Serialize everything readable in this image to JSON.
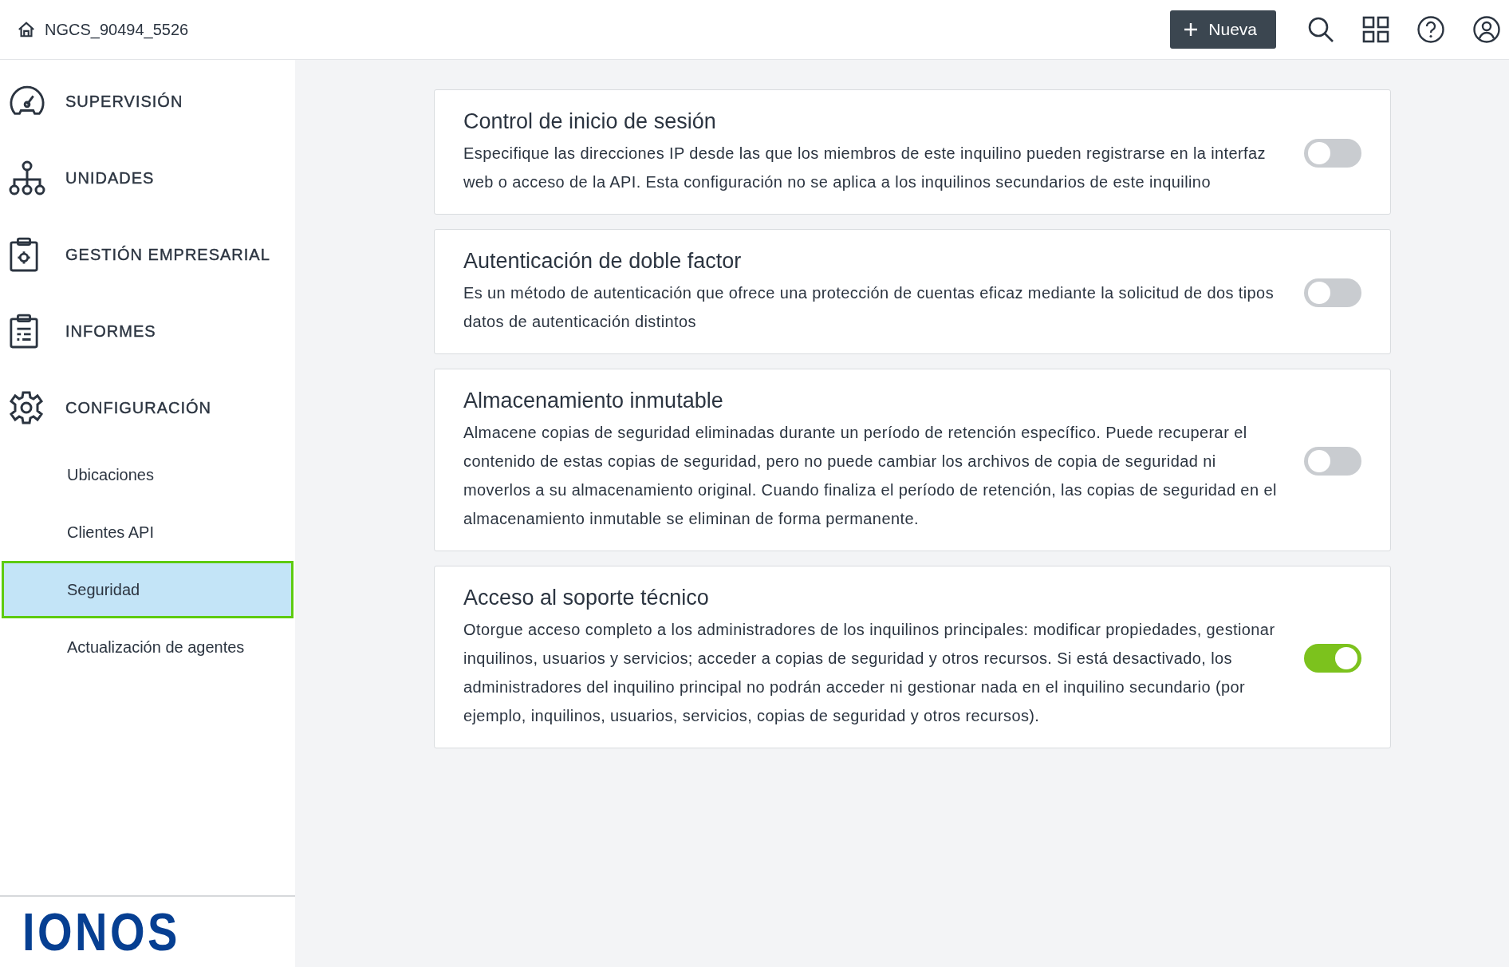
{
  "header": {
    "tenant": "NGCS_90494_5526",
    "new_button": "Nueva"
  },
  "sidebar": {
    "items": [
      {
        "label": "SUPERVISIÓN",
        "selected": false
      },
      {
        "label": "UNIDADES",
        "selected": false
      },
      {
        "label": "GESTIÓN EMPRESARIAL",
        "selected": false
      },
      {
        "label": "INFORMES",
        "selected": false
      },
      {
        "label": "CONFIGURACIÓN",
        "selected": false,
        "children": [
          {
            "label": "Ubicaciones",
            "selected": false
          },
          {
            "label": "Clientes API",
            "selected": false
          },
          {
            "label": "Seguridad",
            "selected": true
          },
          {
            "label": "Actualización de agentes",
            "selected": false
          }
        ]
      }
    ],
    "logo": "IONOS"
  },
  "settings": [
    {
      "title": "Control de inicio de sesión",
      "description": "Especifique las direcciones IP desde las que los miembros de este inquilino pueden registrarse en la interfaz web o acceso de la API. Esta configuración no se aplica a los inquilinos secundarios de este inquilino",
      "on": false
    },
    {
      "title": "Autenticación de doble factor",
      "description": "Es un método de autenticación que ofrece una protección de cuentas eficaz mediante la solicitud de dos tipos datos de autenticación distintos",
      "on": false
    },
    {
      "title": "Almacenamiento inmutable",
      "description": "Almacene copias de seguridad eliminadas durante un período de retención específico. Puede recuperar el contenido de estas copias de seguridad, pero no puede cambiar los archivos de copia de seguridad ni moverlos a su almacenamiento original. Cuando finaliza el período de retención, las copias de seguridad en el almacenamiento inmutable se eliminan de forma permanente.",
      "on": false
    },
    {
      "title": "Acceso al soporte técnico",
      "description": "Otorgue acceso completo a los administradores de los inquilinos principales: modificar propiedades, gestionar inquilinos, usuarios y servicios; acceder a copias de seguridad y otros recursos. Si está desactivado, los administradores del inquilino principal no podrán acceder ni gestionar nada en el inquilino secundario (por ejemplo, inquilinos, usuarios, servicios, copias de seguridad y otros recursos).",
      "on": true
    }
  ]
}
